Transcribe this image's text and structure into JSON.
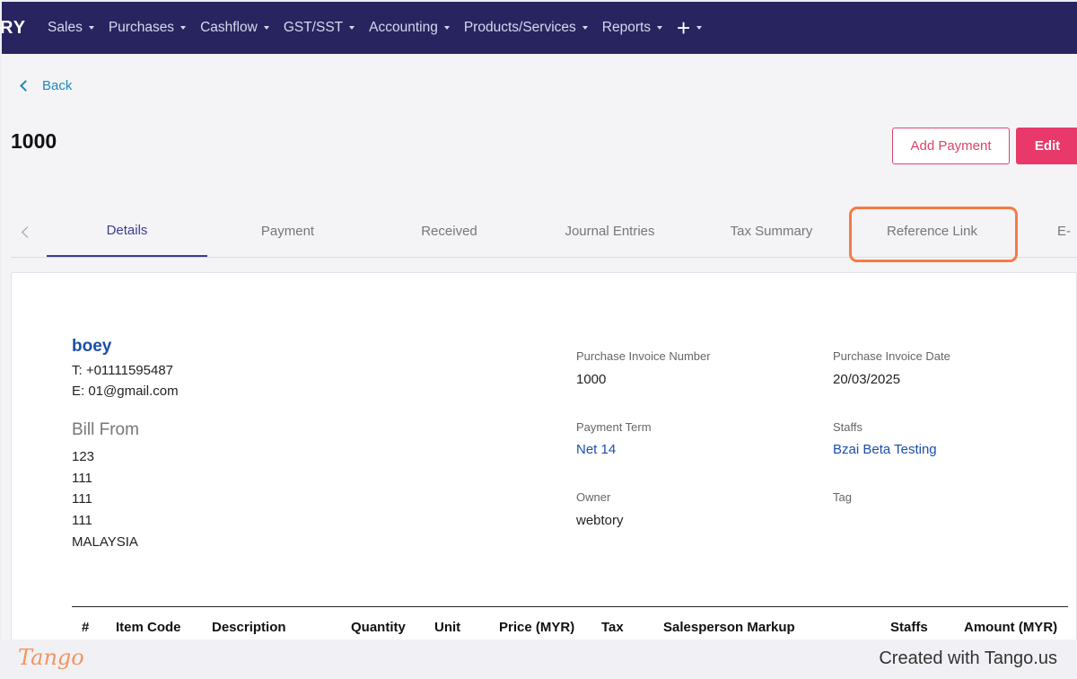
{
  "app": {
    "brand_fragment": "RY",
    "nav": [
      {
        "label": "Sales"
      },
      {
        "label": "Purchases"
      },
      {
        "label": "Cashflow"
      },
      {
        "label": "GST/SST"
      },
      {
        "label": "Accounting"
      },
      {
        "label": "Products/Services"
      },
      {
        "label": "Reports"
      }
    ],
    "nav_add_icon": "plus-icon"
  },
  "page": {
    "back_label": "Back",
    "title": "1000",
    "add_payment_label": "Add Payment",
    "edit_label": "Edit",
    "tabs": [
      {
        "label": "Details",
        "active": true
      },
      {
        "label": "Payment"
      },
      {
        "label": "Received"
      },
      {
        "label": "Journal Entries"
      },
      {
        "label": "Tax Summary"
      },
      {
        "label": "Reference Link",
        "highlighted": true
      },
      {
        "label": "E-"
      }
    ]
  },
  "invoice": {
    "vendor": {
      "name": "boey",
      "phone": "T: +01111595487",
      "email": "E: 01@gmail.com"
    },
    "bill_from_heading": "Bill From",
    "address": [
      "123",
      "111",
      "111",
      "111",
      "MALAYSIA"
    ],
    "fields": {
      "number_label": "Purchase Invoice Number",
      "number_value": "1000",
      "date_label": "Purchase Invoice Date",
      "date_value": "20/03/2025",
      "term_label": "Payment Term",
      "term_value": "Net 14",
      "staffs_label": "Staffs",
      "staffs_value": "Bzai Beta Testing",
      "owner_label": "Owner",
      "owner_value": "webtory",
      "tag_label": "Tag"
    },
    "table_headers": [
      "#",
      "Item Code",
      "Description",
      "Quantity",
      "Unit",
      "Price (MYR)",
      "Tax",
      "Salesperson Markup",
      "Staffs",
      "Amount (MYR)"
    ]
  },
  "footer": {
    "logo_text": "Tango",
    "credit": "Created with Tango.us"
  },
  "colors": {
    "nav_bg": "#28245f",
    "accent_pink": "#e8396a",
    "link_blue": "#1a4fa8",
    "highlight_orange": "#f77a44"
  }
}
